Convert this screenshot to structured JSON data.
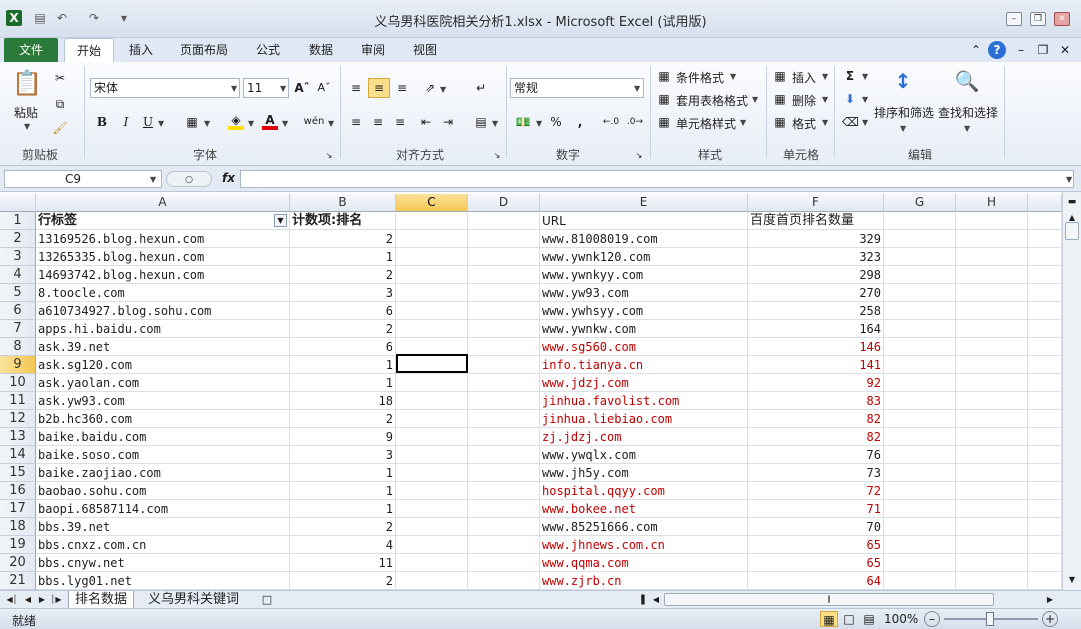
{
  "window": {
    "title": "义乌男科医院相关分析1.xlsx - Microsoft Excel (试用版)"
  },
  "tabs": [
    "文件",
    "开始",
    "插入",
    "页面布局",
    "公式",
    "数据",
    "审阅",
    "视图"
  ],
  "ribbon": {
    "clipboard": {
      "label": "剪贴板",
      "paste": "粘贴"
    },
    "font": {
      "label": "字体",
      "name": "宋体",
      "size": "11",
      "bold": "B",
      "italic": "I",
      "underline": "U",
      "wen": "wén"
    },
    "alignment": {
      "label": "对齐方式"
    },
    "number": {
      "label": "数字",
      "format": "常规",
      "percent": "%",
      "comma": ","
    },
    "styles": {
      "label": "样式",
      "conditional": "条件格式",
      "table": "套用表格格式",
      "cell": "单元格样式"
    },
    "cells": {
      "label": "单元格",
      "insert": "插入",
      "delete": "删除",
      "format": "格式"
    },
    "editing": {
      "label": "编辑",
      "sort": "排序和筛选",
      "find": "查找和选择",
      "sigma": "Σ"
    }
  },
  "formula_bar": {
    "name_box": "C9",
    "fx": "fx",
    "value": ""
  },
  "columns": [
    "A",
    "B",
    "C",
    "D",
    "E",
    "F",
    "G",
    "H"
  ],
  "selected_column": "C",
  "selected_row": "9",
  "header_row": {
    "a": "行标签",
    "b": "计数项:排名",
    "e": "URL",
    "f": "百度首页排名数量"
  },
  "rows": [
    {
      "n": "2",
      "a": "13169526.blog.hexun.com",
      "b": "2",
      "e": "www.81008019.com",
      "f": "329",
      "red": false
    },
    {
      "n": "3",
      "a": "13265335.blog.hexun.com",
      "b": "1",
      "e": "www.ywnk120.com",
      "f": "323",
      "red": false
    },
    {
      "n": "4",
      "a": "14693742.blog.hexun.com",
      "b": "2",
      "e": "www.ywnkyy.com",
      "f": "298",
      "red": false
    },
    {
      "n": "5",
      "a": "8.toocle.com",
      "b": "3",
      "e": "www.yw93.com",
      "f": "270",
      "red": false
    },
    {
      "n": "6",
      "a": "a610734927.blog.sohu.com",
      "b": "6",
      "e": "www.ywhsyy.com",
      "f": "258",
      "red": false
    },
    {
      "n": "7",
      "a": "apps.hi.baidu.com",
      "b": "2",
      "e": "www.ywnkw.com",
      "f": "164",
      "red": false
    },
    {
      "n": "8",
      "a": "ask.39.net",
      "b": "6",
      "e": "www.sg560.com",
      "f": "146",
      "red": true
    },
    {
      "n": "9",
      "a": "ask.sg120.com",
      "b": "1",
      "e": "info.tianya.cn",
      "f": "141",
      "red": true
    },
    {
      "n": "10",
      "a": "ask.yaolan.com",
      "b": "1",
      "e": "www.jdzj.com",
      "f": "92",
      "red": true
    },
    {
      "n": "11",
      "a": "ask.yw93.com",
      "b": "18",
      "e": "jinhua.favolist.com",
      "f": "83",
      "red": true
    },
    {
      "n": "12",
      "a": "b2b.hc360.com",
      "b": "2",
      "e": "jinhua.liebiao.com",
      "f": "82",
      "red": true
    },
    {
      "n": "13",
      "a": "baike.baidu.com",
      "b": "9",
      "e": "zj.jdzj.com",
      "f": "82",
      "red": true
    },
    {
      "n": "14",
      "a": "baike.soso.com",
      "b": "3",
      "e": "www.ywqlx.com",
      "f": "76",
      "red": false
    },
    {
      "n": "15",
      "a": "baike.zaojiao.com",
      "b": "1",
      "e": "www.jh5y.com",
      "f": "73",
      "red": false
    },
    {
      "n": "16",
      "a": "baobao.sohu.com",
      "b": "1",
      "e": "hospital.qqyy.com",
      "f": "72",
      "red": true
    },
    {
      "n": "17",
      "a": "baopi.68587114.com",
      "b": "1",
      "e": "www.bokee.net",
      "f": "71",
      "red": true
    },
    {
      "n": "18",
      "a": "bbs.39.net",
      "b": "2",
      "e": "www.85251666.com",
      "f": "70",
      "red": false
    },
    {
      "n": "19",
      "a": "bbs.cnxz.com.cn",
      "b": "4",
      "e": "www.jhnews.com.cn",
      "f": "65",
      "red": true
    },
    {
      "n": "20",
      "a": "bbs.cnyw.net",
      "b": "11",
      "e": "www.qqma.com",
      "f": "65",
      "red": true
    },
    {
      "n": "21",
      "a": "bbs.lyg01.net",
      "b": "2",
      "e": "www.zjrb.cn",
      "f": "64",
      "red": true
    }
  ],
  "sheets": [
    "排名数据",
    "义乌男科关键词"
  ],
  "status": {
    "ready": "就绪",
    "zoom": "100%"
  },
  "colors": {
    "file_tab": "#2b7a3a",
    "selected_header": "#f4c653",
    "red_text": "#c00000"
  }
}
